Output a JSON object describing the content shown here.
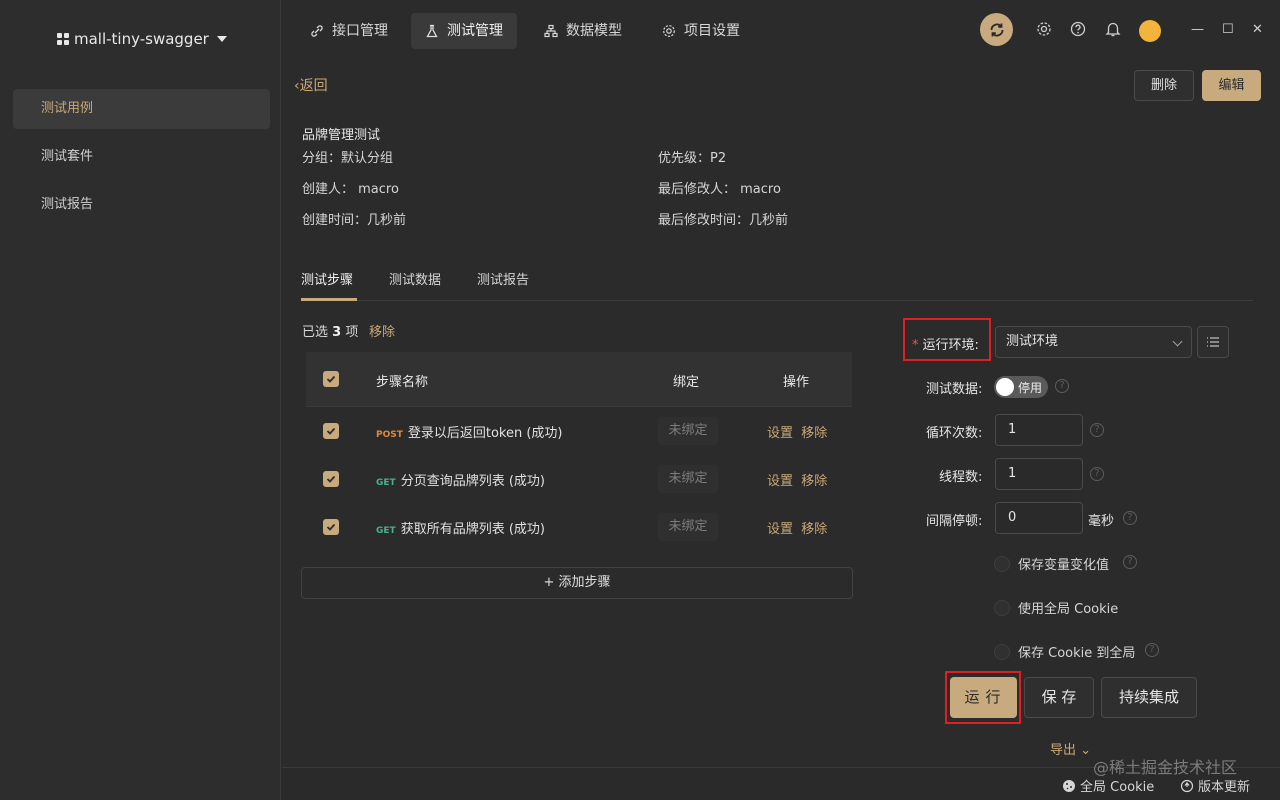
{
  "project": {
    "name": "mall-tiny-swagger"
  },
  "sidebar": {
    "items": [
      {
        "label": "测试用例",
        "active": true
      },
      {
        "label": "测试套件",
        "active": false
      },
      {
        "label": "测试报告",
        "active": false
      }
    ]
  },
  "topnav": {
    "tabs": [
      {
        "label": "接口管理",
        "icon": "link-icon"
      },
      {
        "label": "测试管理",
        "icon": "flask-icon",
        "active": true
      },
      {
        "label": "数据模型",
        "icon": "model-icon"
      },
      {
        "label": "项目设置",
        "icon": "gear-icon"
      }
    ],
    "window": {
      "minimize": "—",
      "maximize": "☐",
      "close": "✕"
    }
  },
  "header": {
    "back_label": "返回",
    "delete_label": "删除",
    "edit_label": "编辑"
  },
  "testcase": {
    "title": "品牌管理测试",
    "group": "分组：默认分组",
    "priority": "优先级：P2",
    "creator": "创建人：  macro",
    "last_modifier": "最后修改人：  macro",
    "created_time": "创建时间：几秒前",
    "modified_time": "最后修改时间：几秒前"
  },
  "subtabs": [
    "测试步骤",
    "测试数据",
    "测试报告"
  ],
  "steps": {
    "selected_prefix": "已选",
    "selected_count": "3",
    "selected_suffix": "项",
    "remove_label": "移除",
    "columns": {
      "name": "步骤名称",
      "bind": "绑定",
      "ops": "操作"
    },
    "rows": [
      {
        "method": "POST",
        "name": "登录以后返回token (成功)",
        "bind": "未绑定",
        "op_set": "设置",
        "op_remove": "移除"
      },
      {
        "method": "GET",
        "name": "分页查询品牌列表 (成功)",
        "bind": "未绑定",
        "op_set": "设置",
        "op_remove": "移除"
      },
      {
        "method": "GET",
        "name": "获取所有品牌列表 (成功)",
        "bind": "未绑定",
        "op_set": "设置",
        "op_remove": "移除"
      }
    ],
    "add_label": "添加步骤"
  },
  "run_form": {
    "env_label": "运行环境:",
    "env_value": "测试环境",
    "data_label": "测试数据:",
    "data_toggle": "停用",
    "loop_label": "循环次数:",
    "loop_value": "1",
    "thread_label": "线程数:",
    "thread_value": "1",
    "interval_label": "间隔停顿:",
    "interval_value": "0",
    "interval_unit": "毫秒",
    "opt_save_var": "保存变量变化值",
    "opt_global_cookie": "使用全局 Cookie",
    "opt_save_cookie": "保存 Cookie 到全局",
    "run_label": "运行",
    "save_label": "保 存",
    "ci_label": "持续集成",
    "export_label": "导出"
  },
  "footer": {
    "global_cookie": "全局 Cookie",
    "update": "版本更新"
  },
  "watermark": "@稀土掘金技术社区",
  "colors": {
    "accent": "#c7aa7e",
    "background": "#2b2b2b",
    "highlight_box": "#e02020"
  }
}
